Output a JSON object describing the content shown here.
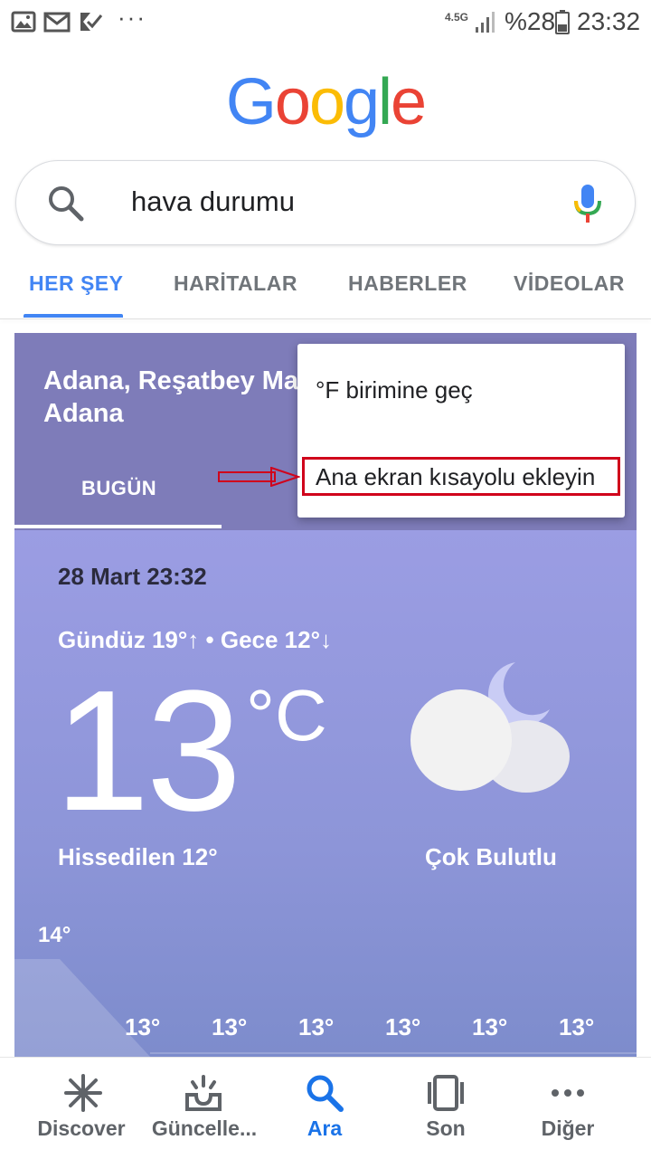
{
  "status_bar": {
    "network": "4.5G",
    "battery": "%28",
    "time": "23:32",
    "more": "···"
  },
  "logo": {
    "letters": [
      {
        "ch": "G",
        "color": "#4285f4"
      },
      {
        "ch": "o",
        "color": "#ea4335"
      },
      {
        "ch": "o",
        "color": "#fbbc05"
      },
      {
        "ch": "g",
        "color": "#4285f4"
      },
      {
        "ch": "l",
        "color": "#34a853"
      },
      {
        "ch": "e",
        "color": "#ea4335"
      }
    ]
  },
  "search": {
    "query": "hava durumu",
    "search_icon": "search-icon",
    "mic_icon": "mic-icon"
  },
  "tabs": [
    {
      "label": "HER ŞEY",
      "active": true
    },
    {
      "label": "HARİTALAR"
    },
    {
      "label": "HABERLER"
    },
    {
      "label": "VİDEOLAR"
    }
  ],
  "weather": {
    "location_line1": "Adana, Reşatbey Ma",
    "location_line2": "Adana",
    "today_tab": "BUGÜN",
    "datetime": "28 Mart 23:32",
    "day_night": "Gündüz 19°↑ • Gece 12°↓",
    "temperature": "13",
    "unit": "°C",
    "feels_like": "Hissedilen 12°",
    "condition": "Çok Bulutlu",
    "condition_icon": "cloud-moon-icon",
    "hourly_max": "14°",
    "hourly": [
      "13°",
      "13°",
      "13°",
      "13°",
      "13°",
      "13°"
    ]
  },
  "popup": {
    "item1": "°F birimine geç",
    "item2": "Ana ekran kısayolu ekleyin",
    "highlight_color": "#d0021b"
  },
  "bottom_nav": [
    {
      "label": "Discover",
      "icon": "asterisk-icon"
    },
    {
      "label": "Güncelle...",
      "icon": "inbox-icon"
    },
    {
      "label": "Ara",
      "icon": "search-icon",
      "active": true
    },
    {
      "label": "Son",
      "icon": "cards-icon"
    },
    {
      "label": "Diğer",
      "icon": "more-icon"
    }
  ],
  "colors": {
    "accent": "#4285f4",
    "card_header": "#7e7cb9",
    "card_body": "#9b9de3"
  }
}
